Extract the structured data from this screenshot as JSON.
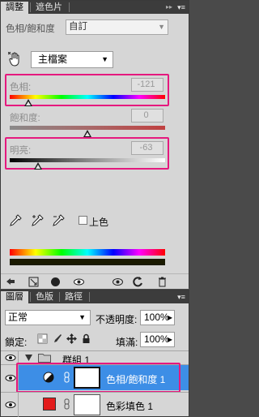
{
  "adjustments": {
    "tabs": [
      {
        "label": "調整",
        "active": true
      },
      {
        "label": "遮色片",
        "active": false
      }
    ],
    "preset_label": "色相/飽和度",
    "preset_value": "自訂",
    "channel": "主檔案",
    "sliders": [
      {
        "label": "色相:",
        "value": "-121",
        "fraction": 0.12
      },
      {
        "label": "飽和度:",
        "value": "0",
        "fraction": 0.5
      },
      {
        "label": "明亮:",
        "value": "-63",
        "fraction": 0.18
      }
    ],
    "colorize_label": "上色",
    "colorize_checked": false
  },
  "layers": {
    "tabs": [
      {
        "label": "圖層",
        "active": true
      },
      {
        "label": "色版",
        "active": false
      },
      {
        "label": "路徑",
        "active": false
      }
    ],
    "blend_mode": "正常",
    "opacity_label": "不透明度:",
    "opacity_value": "100%",
    "lock_label": "鎖定:",
    "fill_label": "填滿:",
    "fill_value": "100%",
    "rows": [
      {
        "name": "群組 1",
        "type": "group",
        "selected": false
      },
      {
        "name": "色相/飽和度 1",
        "type": "adjustment",
        "selected": true
      },
      {
        "name": "色彩填色 1",
        "type": "fill",
        "selected": false,
        "swatch": "#e31b1b"
      }
    ]
  },
  "colors": {
    "highlight": "#e5197e",
    "selected_row": "#3d8ee6",
    "panel_bg": "#d6d6d6"
  }
}
